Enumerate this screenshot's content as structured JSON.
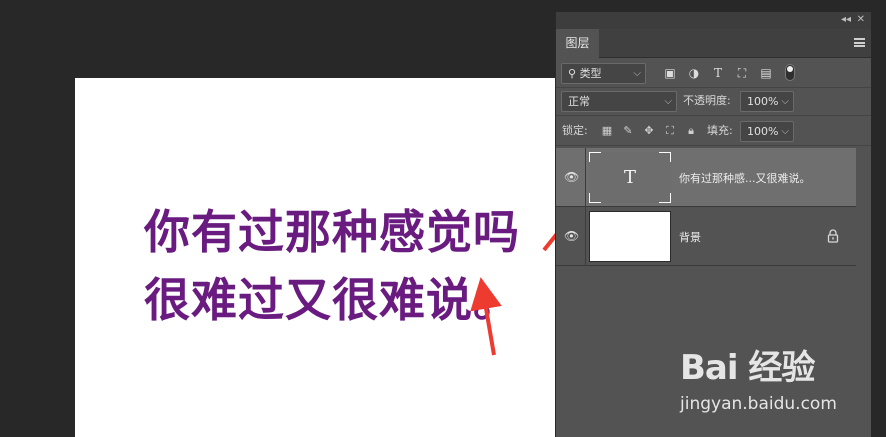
{
  "canvas": {
    "text_lines": [
      "你有过那种感觉吗",
      "很难过又很难说。"
    ],
    "text_color": "#6a1b80"
  },
  "panel": {
    "tab_label": "图层",
    "filter": {
      "select_value": "类型",
      "icons": [
        "image-filter-icon",
        "adjustment-filter-icon",
        "type-filter-icon",
        "shape-filter-icon",
        "smart-object-filter-icon",
        "filter-toggle"
      ]
    },
    "blend": {
      "mode_value": "正常",
      "opacity_label": "不透明度:",
      "opacity_value": "100%"
    },
    "lock": {
      "label": "锁定:",
      "fill_label": "填充:",
      "fill_value": "100%"
    },
    "layers": [
      {
        "name": "你有过那种感...又很难说。",
        "type": "text",
        "thumb_glyph": "T",
        "visible": true,
        "selected": true
      },
      {
        "name": "背景",
        "type": "background",
        "visible": true,
        "locked": true
      }
    ]
  },
  "watermark": {
    "logo": "Bai 经验",
    "url": "jingyan.baidu.com"
  }
}
